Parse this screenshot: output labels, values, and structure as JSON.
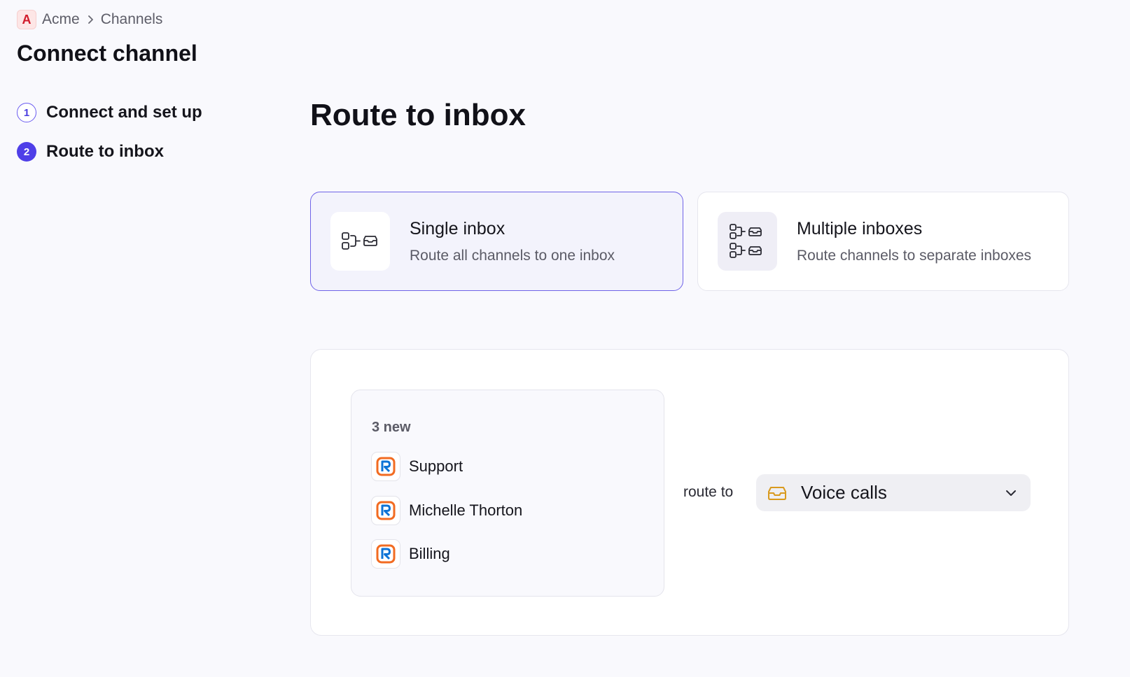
{
  "breadcrumb": {
    "workspace_initial": "A",
    "workspace": "Acme",
    "section": "Channels"
  },
  "page_title": "Connect channel",
  "steps": [
    {
      "number": "1",
      "label": "Connect and set up",
      "state": "done"
    },
    {
      "number": "2",
      "label": "Route to inbox",
      "state": "current"
    }
  ],
  "section_title": "Route to inbox",
  "options": [
    {
      "title": "Single inbox",
      "description": "Route all channels to one inbox",
      "icon": "single-route-icon",
      "selected": true
    },
    {
      "title": "Multiple inboxes",
      "description": "Route channels to separate inboxes",
      "icon": "multi-route-icon",
      "selected": false
    }
  ],
  "channels": {
    "count_label": "3 new",
    "items": [
      {
        "name": "Support",
        "icon": "ringcentral-icon"
      },
      {
        "name": "Michelle Thorton",
        "icon": "ringcentral-icon"
      },
      {
        "name": "Billing",
        "icon": "ringcentral-icon"
      }
    ]
  },
  "route": {
    "label": "route to",
    "selected_inbox": "Voice calls",
    "inbox_icon_color": "#d99a1e"
  },
  "colors": {
    "accent": "#4f3fe8",
    "logo_orange": "#f26b21",
    "logo_blue": "#0d73d6",
    "workspace_red": "#d11a2a"
  }
}
